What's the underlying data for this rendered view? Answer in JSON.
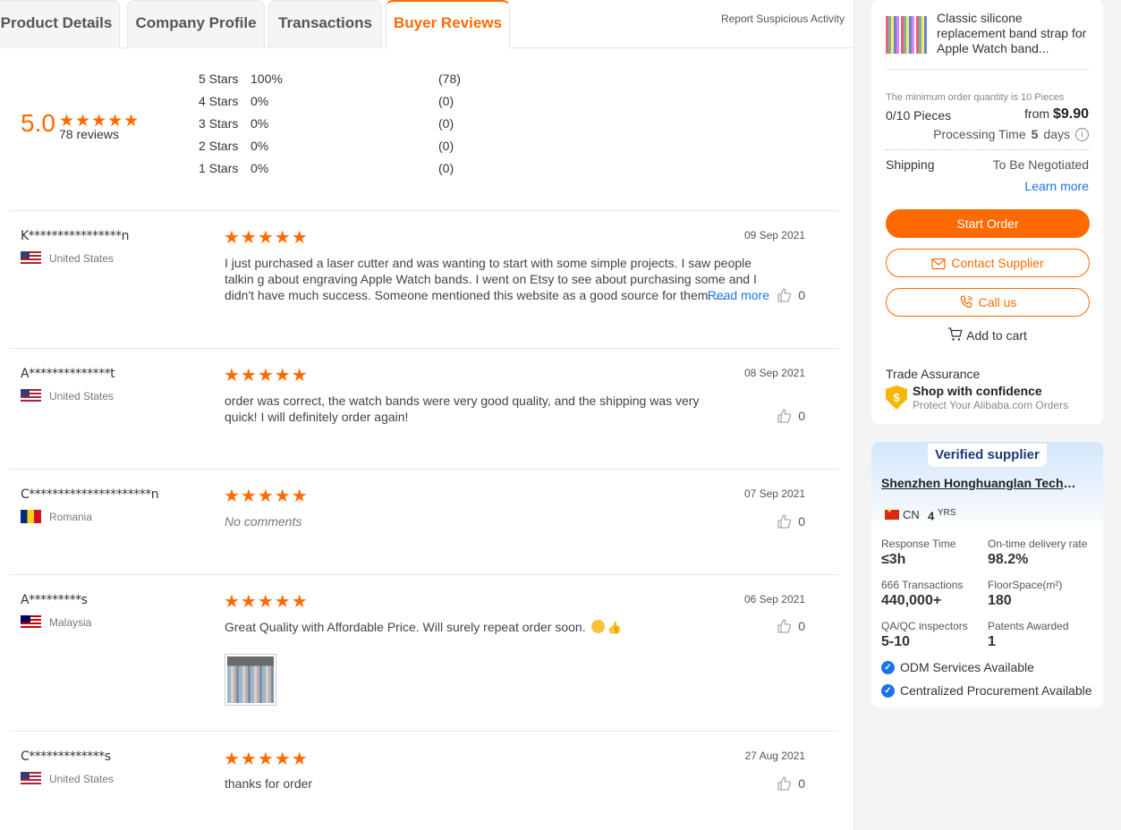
{
  "tabs": [
    {
      "label": "Product Details"
    },
    {
      "label": "Company Profile"
    },
    {
      "label": "Transactions"
    },
    {
      "label": "Buyer Reviews",
      "active": true
    }
  ],
  "report_label": "Report Suspicious Activity",
  "summary": {
    "score": "5.0",
    "rating": 5,
    "review_count": "78 reviews",
    "distribution": [
      {
        "label": "5  Stars",
        "percent": "100%",
        "count": "(78)"
      },
      {
        "label": "4  Stars",
        "percent": "0%",
        "count": "(0)"
      },
      {
        "label": "3  Stars",
        "percent": "0%",
        "count": "(0)"
      },
      {
        "label": "2  Stars",
        "percent": "0%",
        "count": "(0)"
      },
      {
        "label": "1  Stars",
        "percent": "0%",
        "count": "(0)"
      }
    ]
  },
  "reviews": [
    {
      "reviewer": "K****************n",
      "country": "United States",
      "date": "09 Sep 2021",
      "rating": 5,
      "comment": "I just purchased a laser cutter and was wanting to start with some simple projects. I saw people talkin g about engraving Apple Watch bands. I went on Etsy to see about purchasing some and I didn't have much success. Someone mentioned this website as a good source for them. ...",
      "read_more": "Read more",
      "likes": "0"
    },
    {
      "reviewer": "A**************t",
      "country": "United States",
      "date": "08 Sep 2021",
      "rating": 5,
      "comment": "order was correct, the watch bands were very good quality, and the shipping was very quick! I will definitely order again!",
      "likes": "0"
    },
    {
      "reviewer": "C*********************n",
      "country": "Romania",
      "date": "07 Sep 2021",
      "rating": 5,
      "comment": "No comments",
      "likes": "0"
    },
    {
      "reviewer": "A*********s",
      "country": "Malaysia",
      "date": "06 Sep 2021",
      "rating": 5,
      "comment": "Great Quality with Affordable Price. Will surely repeat order soon.",
      "likes": "0"
    },
    {
      "reviewer": "C*************s",
      "country": "United States",
      "date": "27 Aug 2021",
      "rating": 5,
      "comment": "thanks for order",
      "likes": "0"
    }
  ],
  "order_card": {
    "product_title": "Classic silicone replacement band strap for Apple Watch band...",
    "moq_note": "The minimum order quantity is 10 Pieces",
    "pieces": "0/10 Pieces",
    "price_prefix": "from",
    "price": "$9.90",
    "processing_label": "Processing Time",
    "processing_days": "5",
    "processing_unit": "days",
    "shipping_label": "Shipping",
    "shipping_value": "To Be Negotiated",
    "learn_more": "Learn more",
    "start_order": "Start Order",
    "contact_supplier": "Contact Supplier",
    "call_us": "Call us",
    "add_to_cart": "Add to cart",
    "trade_assurance": "Trade Assurance",
    "shop_confidence": "Shop with confidence",
    "protect": "Protect Your Alibaba.com Orders"
  },
  "supplier": {
    "badge_v": "V",
    "badge_rest": "erified supplier",
    "name": "Shenzhen Honghuanglan Technology Co., Ltd.",
    "country": "CN",
    "years": "4",
    "years_unit": "YRS",
    "stats": [
      {
        "label": "Response Time",
        "value": "≤3h"
      },
      {
        "label": "On-time delivery rate",
        "value": "98.2%"
      },
      {
        "label": "666 Transactions",
        "value": "440,000+"
      },
      {
        "label": "FloorSpace(m²)",
        "value": "180"
      },
      {
        "label": "QA/QC inspectors",
        "value": "5-10"
      },
      {
        "label": "Patents Awarded",
        "value": "1"
      }
    ],
    "capabilities": [
      "ODM Services Available",
      "Centralized Procurement Available"
    ]
  },
  "colors": {
    "accent": "#ff6a00",
    "link": "#1a73e8"
  }
}
